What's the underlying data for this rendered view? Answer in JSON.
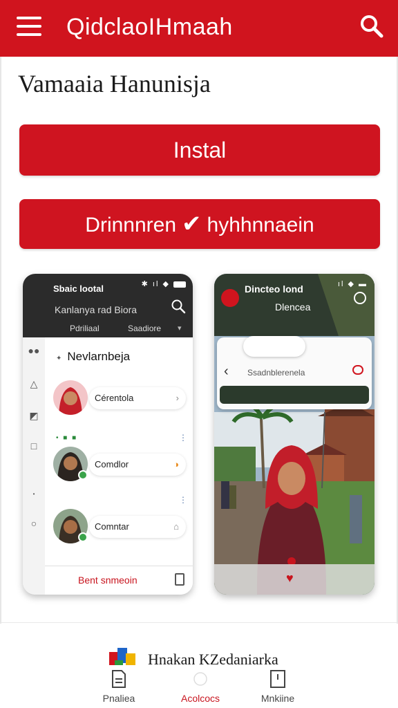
{
  "app": {
    "title": "QidclaoIHmaah",
    "subtitle": "Vamaaia Hanunisja",
    "accent": "#d0141e"
  },
  "buttons": {
    "install": "Instal",
    "secondary_left": "Drinnnren",
    "secondary_right": "hyhhnnaein"
  },
  "phone_a": {
    "status": "Sbaic lootal",
    "search_text": "Kanlanya rad Biora",
    "tabs": [
      "Pdriliaal",
      "Saadiore"
    ],
    "section_title": "Nevlarnbeja",
    "mini_label": "• ■ ■",
    "contacts": [
      {
        "name": "Cérentola"
      },
      {
        "name": "Comdlor"
      },
      {
        "name": "Comntar"
      }
    ],
    "footer_label": "Bent snmeoin"
  },
  "phone_b": {
    "title_line1": "Dincteo lond",
    "title_line2": "Dlencea",
    "card_text": "Ssadnblerenela"
  },
  "footer": {
    "brand_text": "Hnakan KZedaniarka"
  },
  "tabs": [
    {
      "label": "Pnaliea",
      "icon": "document-icon",
      "active": false
    },
    {
      "label": "Acolcocs",
      "icon": "globe-icon",
      "active": true
    },
    {
      "label": "Mnkiine",
      "icon": "book-icon",
      "active": false
    }
  ]
}
